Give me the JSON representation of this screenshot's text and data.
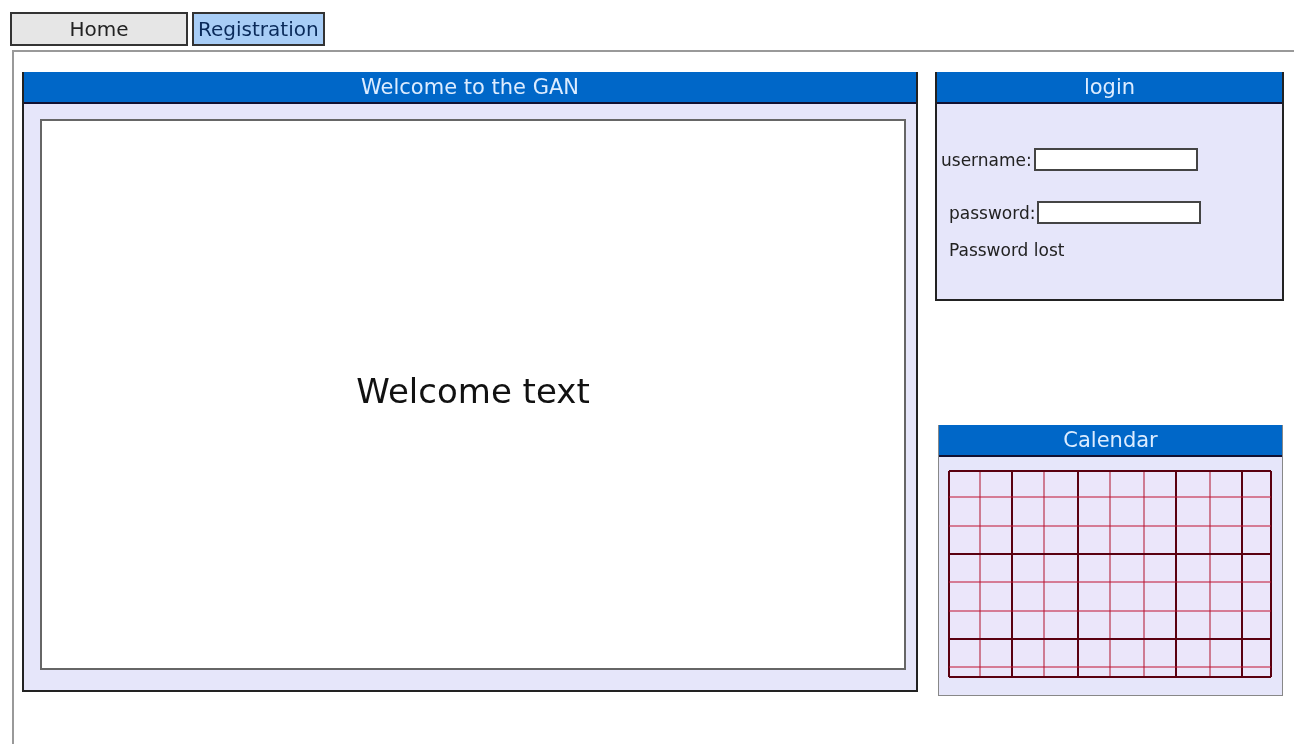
{
  "tabs": [
    {
      "label": "Home",
      "selected": false
    },
    {
      "label": "Registration",
      "selected": true
    }
  ],
  "welcome_panel": {
    "title": "Welcome to the GAN",
    "text": "Welcome text"
  },
  "login_panel": {
    "title": "login",
    "fields": [
      {
        "label": "username:"
      },
      {
        "label": "password:"
      }
    ],
    "link": "Password lost"
  },
  "calendar_panel": {
    "title": "Calendar"
  }
}
